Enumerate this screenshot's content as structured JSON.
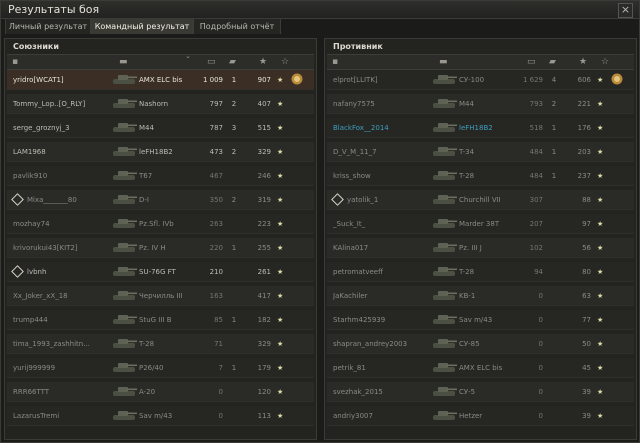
{
  "window": {
    "title": "Результаты боя",
    "close_label": "×"
  },
  "tabs": [
    {
      "label": "Личный результат",
      "active": false
    },
    {
      "label": "Командный результат",
      "active": true
    },
    {
      "label": "Подробный отчёт",
      "active": false
    }
  ],
  "allies": {
    "title": "Союзники",
    "rows": [
      {
        "name": "yridro[WCAT1]",
        "vehicle": "AMX ELC bis",
        "damage": "1 009",
        "kills": "1",
        "xp": "907",
        "prem": "★",
        "medal": true,
        "dead": false,
        "highlight": true,
        "platoon": false
      },
      {
        "name": "Tommy_Lop..[O_RLY]",
        "vehicle": "Nashorn",
        "damage": "797",
        "kills": "2",
        "xp": "407",
        "prem": "★",
        "dead": false,
        "platoon": false
      },
      {
        "name": "serge_groznyj_3",
        "vehicle": "M44",
        "damage": "787",
        "kills": "3",
        "xp": "515",
        "prem": "★",
        "dead": false,
        "platoon": false
      },
      {
        "name": "LAM1968",
        "vehicle": "leFH18B2",
        "damage": "473",
        "kills": "2",
        "xp": "329",
        "prem": "★",
        "dead": false,
        "platoon": false
      },
      {
        "name": "pavlik910",
        "vehicle": "T67",
        "damage": "467",
        "kills": "",
        "xp": "246",
        "prem": "★",
        "dead": true,
        "platoon": false
      },
      {
        "name": "Mixa_______80",
        "vehicle": "D-I",
        "damage": "350",
        "kills": "2",
        "xp": "319",
        "prem": "★",
        "dead": true,
        "platoon": true
      },
      {
        "name": "mozhay74",
        "vehicle": "Pz.Sfl. IVb",
        "damage": "263",
        "kills": "",
        "xp": "223",
        "prem": "★",
        "dead": true,
        "platoon": false
      },
      {
        "name": "krivorukui43[KIT2]",
        "vehicle": "Pz. IV H",
        "damage": "220",
        "kills": "1",
        "xp": "255",
        "prem": "★",
        "dead": true,
        "platoon": false
      },
      {
        "name": "lvbnh",
        "vehicle": "SU-76G FT",
        "damage": "210",
        "kills": "",
        "xp": "261",
        "prem": "★",
        "dead": false,
        "platoon": true
      },
      {
        "name": "Xx_Joker_xX_18",
        "vehicle": "Черчилль III",
        "damage": "163",
        "kills": "",
        "xp": "417",
        "prem": "★",
        "dead": true,
        "platoon": false
      },
      {
        "name": "trump444",
        "vehicle": "StuG III B",
        "damage": "85",
        "kills": "1",
        "xp": "182",
        "prem": "★",
        "dead": true,
        "platoon": false
      },
      {
        "name": "tima_1993_zashhitn...",
        "vehicle": "T-28",
        "damage": "71",
        "kills": "",
        "xp": "329",
        "prem": "★",
        "dead": true,
        "platoon": false
      },
      {
        "name": "yurij999999",
        "vehicle": "P26/40",
        "damage": "7",
        "kills": "1",
        "xp": "179",
        "prem": "★",
        "dead": true,
        "platoon": false
      },
      {
        "name": "RRR66TTT",
        "vehicle": "A-20",
        "damage": "0",
        "kills": "",
        "xp": "120",
        "prem": "★",
        "dead": true,
        "platoon": false
      },
      {
        "name": "LazarusTremi",
        "vehicle": "Sav m/43",
        "damage": "0",
        "kills": "",
        "xp": "113",
        "prem": "★",
        "dead": true,
        "platoon": false
      }
    ]
  },
  "enemies": {
    "title": "Противник",
    "rows": [
      {
        "name": "elprot[LLITK]",
        "vehicle": "СУ-100",
        "damage": "1 629",
        "kills": "4",
        "xp": "606",
        "prem": "★",
        "medal": true,
        "dead": true,
        "platoon": false
      },
      {
        "name": "nafany7575",
        "vehicle": "M44",
        "damage": "793",
        "kills": "2",
        "xp": "221",
        "prem": "★",
        "dead": true,
        "platoon": false
      },
      {
        "name": "BlackFox__2014",
        "vehicle": "leFH18B2",
        "damage": "518",
        "kills": "1",
        "xp": "176",
        "prem": "★",
        "dead": true,
        "blue": true,
        "platoon": false
      },
      {
        "name": "D_V_M_11_7",
        "vehicle": "T-34",
        "damage": "484",
        "kills": "1",
        "xp": "203",
        "prem": "★",
        "dead": true,
        "platoon": false
      },
      {
        "name": "kriss_show",
        "vehicle": "T-28",
        "damage": "484",
        "kills": "1",
        "xp": "237",
        "prem": "★",
        "dead": true,
        "platoon": false
      },
      {
        "name": "yatolik_1",
        "vehicle": "Churchill VII",
        "damage": "307",
        "kills": "",
        "xp": "88",
        "prem": "★",
        "dead": true,
        "platoon": true
      },
      {
        "name": "_Suck_It_",
        "vehicle": "Marder 38T",
        "damage": "207",
        "kills": "",
        "xp": "97",
        "prem": "★",
        "dead": true,
        "platoon": false
      },
      {
        "name": "KAlina017",
        "vehicle": "Pz. III J",
        "damage": "102",
        "kills": "",
        "xp": "56",
        "prem": "★",
        "dead": true,
        "platoon": false
      },
      {
        "name": "petromatveeff",
        "vehicle": "T-28",
        "damage": "94",
        "kills": "",
        "xp": "80",
        "prem": "★",
        "dead": true,
        "platoon": false
      },
      {
        "name": "JaKachiler",
        "vehicle": "KB-1",
        "damage": "0",
        "kills": "",
        "xp": "63",
        "prem": "★",
        "dead": true,
        "platoon": false
      },
      {
        "name": "Starhm425939",
        "vehicle": "Sav m/43",
        "damage": "0",
        "kills": "",
        "xp": "77",
        "prem": "★",
        "dead": true,
        "platoon": false
      },
      {
        "name": "shapran_andrey2003",
        "vehicle": "СУ-85",
        "damage": "0",
        "kills": "",
        "xp": "50",
        "prem": "★",
        "dead": true,
        "platoon": false
      },
      {
        "name": "petrik_81",
        "vehicle": "AMX ELC bis",
        "damage": "0",
        "kills": "",
        "xp": "45",
        "prem": "★",
        "dead": true,
        "platoon": false
      },
      {
        "name": "svezhak_2015",
        "vehicle": "СУ-5",
        "damage": "0",
        "kills": "",
        "xp": "39",
        "prem": "★",
        "dead": true,
        "platoon": false
      },
      {
        "name": "andriy3007",
        "vehicle": "Hetzer",
        "damage": "0",
        "kills": "",
        "xp": "39",
        "prem": "★",
        "dead": true,
        "platoon": false
      }
    ]
  },
  "column_icons": [
    "tank-class-icon",
    "vehicle-icon",
    "sort-chevron-icon",
    "damage-icon",
    "kills-icon",
    "xp-star-icon",
    "premium-star-icon"
  ],
  "colors": {
    "background": "#1b1b19",
    "highlight_row": "#3b2f25",
    "platoon_blue": "#3e9fc0"
  }
}
